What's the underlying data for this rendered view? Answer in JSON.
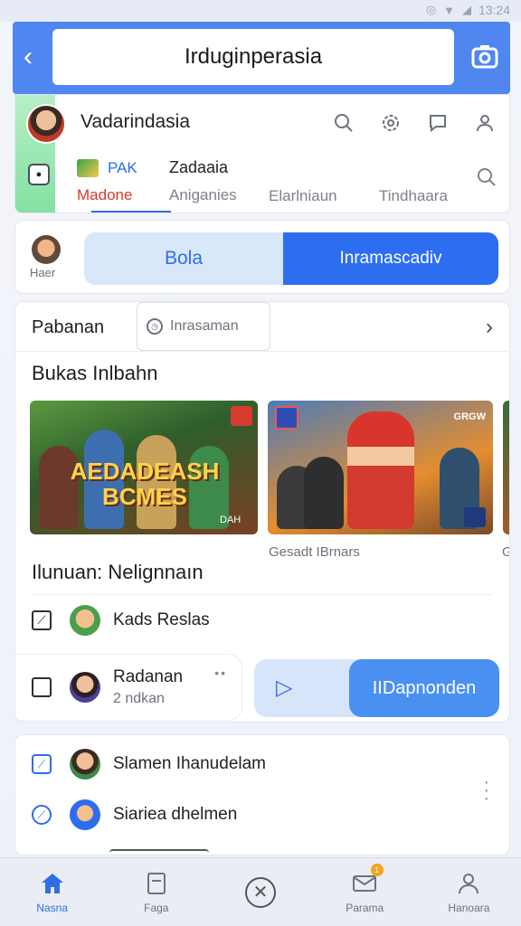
{
  "status_bar": {
    "time": "13:24"
  },
  "app_bar": {
    "title": "Irduginperasia"
  },
  "profile": {
    "name": "Vadarindasia"
  },
  "tabs": [
    {
      "brand": "PAK",
      "label": "Madone"
    },
    {
      "top": "Zadaaia",
      "label": "Aniganies"
    },
    {
      "label": "Elarlniaun"
    },
    {
      "label": "Tindhaara"
    }
  ],
  "toggle": {
    "mini_label": "Haer",
    "left": "Bola",
    "right": "Inramascadiv"
  },
  "main": {
    "header_label": "Pabanan",
    "chip_label": "Inrasaman",
    "section_title": "Bukas Inlbahn",
    "banner1_text": "AEDADEASH BCMES",
    "banner1_small": "DAH",
    "banner2_logo": "GRGW",
    "banner2_caption": "Gesadt IBrnars",
    "banner3_caption": "Ga",
    "section_title2": "Ilunuan: Nelignnaın",
    "row1_label": "Kads Reslas",
    "row2_label": "Radanan",
    "row2_sub": "2 ndkan",
    "cta_label": "IIDapnonden"
  },
  "list": [
    {
      "label": "Slamen Ihanudelam"
    },
    {
      "label": "Siariea dhelmen"
    }
  ],
  "bottom_nav": [
    {
      "label": "Nasna",
      "icon": "home-icon"
    },
    {
      "label": "Faga",
      "icon": "page-icon"
    },
    {
      "label": "",
      "icon": "close-circle-icon"
    },
    {
      "label": "Parama",
      "icon": "mail-icon",
      "badge": "1"
    },
    {
      "label": "Hanoara",
      "icon": "user-icon"
    }
  ],
  "colors": {
    "accent": "#2f6ee8",
    "appbar": "#4f86f0",
    "cta": "#4a90f0",
    "badge": "#f2a41c"
  }
}
